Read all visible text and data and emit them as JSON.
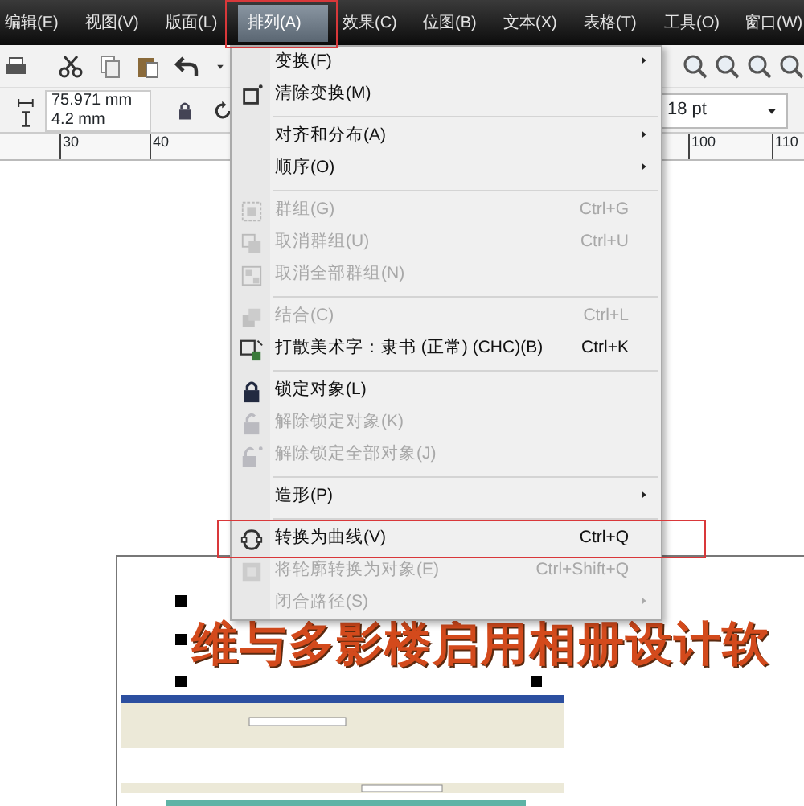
{
  "menubar": [
    {
      "label": "编辑(E)",
      "selected": false
    },
    {
      "label": "视图(V)",
      "selected": false
    },
    {
      "label": "版面(L)",
      "selected": false
    },
    {
      "label": "排列(A)",
      "selected": true
    },
    {
      "label": "效果(C)",
      "selected": false
    },
    {
      "label": "位图(B)",
      "selected": false
    },
    {
      "label": "文本(X)",
      "selected": false
    },
    {
      "label": "表格(T)",
      "selected": false
    },
    {
      "label": "工具(O)",
      "selected": false
    },
    {
      "label": "窗口(W)",
      "selected": false
    }
  ],
  "property_bar": {
    "width": "75.971 mm",
    "height": "4.2 mm",
    "font_size": "18 pt"
  },
  "ruler": [
    "30",
    "40",
    "100",
    "110"
  ],
  "menu": {
    "items": [
      {
        "kind": "item",
        "label": "变换(F)",
        "submenu": true,
        "disabled": false,
        "highlighted": false
      },
      {
        "kind": "item",
        "label": "清除变换(M)",
        "submenu": false,
        "disabled": false,
        "highlighted": false
      },
      {
        "kind": "separator"
      },
      {
        "kind": "item",
        "label": "对齐和分布(A)",
        "submenu": true,
        "disabled": false,
        "highlighted": false
      },
      {
        "kind": "item",
        "label": "顺序(O)",
        "submenu": true,
        "disabled": false,
        "highlighted": false
      },
      {
        "kind": "separator"
      },
      {
        "kind": "item",
        "label": "群组(G)",
        "shortcut": "Ctrl+G",
        "submenu": false,
        "disabled": true,
        "highlighted": false
      },
      {
        "kind": "item",
        "label": "取消群组(U)",
        "shortcut": "Ctrl+U",
        "submenu": false,
        "disabled": true,
        "highlighted": false
      },
      {
        "kind": "item",
        "label": "取消全部群组(N)",
        "submenu": false,
        "disabled": true,
        "highlighted": false
      },
      {
        "kind": "separator"
      },
      {
        "kind": "item",
        "label": "结合(C)",
        "shortcut": "Ctrl+L",
        "submenu": false,
        "disabled": true,
        "highlighted": false
      },
      {
        "kind": "item",
        "label": "打散美术字：隶书 (正常) (CHC)(B)",
        "shortcut": "Ctrl+K",
        "submenu": false,
        "disabled": false,
        "highlighted": false
      },
      {
        "kind": "separator"
      },
      {
        "kind": "item",
        "label": "锁定对象(L)",
        "submenu": false,
        "disabled": false,
        "highlighted": false
      },
      {
        "kind": "item",
        "label": "解除锁定对象(K)",
        "submenu": false,
        "disabled": true,
        "highlighted": false
      },
      {
        "kind": "item",
        "label": "解除锁定全部对象(J)",
        "submenu": false,
        "disabled": true,
        "highlighted": false
      },
      {
        "kind": "separator"
      },
      {
        "kind": "item",
        "label": "造形(P)",
        "submenu": true,
        "disabled": false,
        "highlighted": false
      },
      {
        "kind": "separator"
      },
      {
        "kind": "item",
        "label": "转换为曲线(V)",
        "shortcut": "Ctrl+Q",
        "submenu": false,
        "disabled": false,
        "highlighted": true
      },
      {
        "kind": "item",
        "label": "将轮廓转换为对象(E)",
        "shortcut": "Ctrl+Shift+Q",
        "submenu": false,
        "disabled": true,
        "highlighted": false
      },
      {
        "kind": "item",
        "label": "闭合路径(S)",
        "submenu": true,
        "disabled": true,
        "highlighted": false
      }
    ]
  },
  "canvas": {
    "heading": "维与多影楼启用相册设计软"
  }
}
